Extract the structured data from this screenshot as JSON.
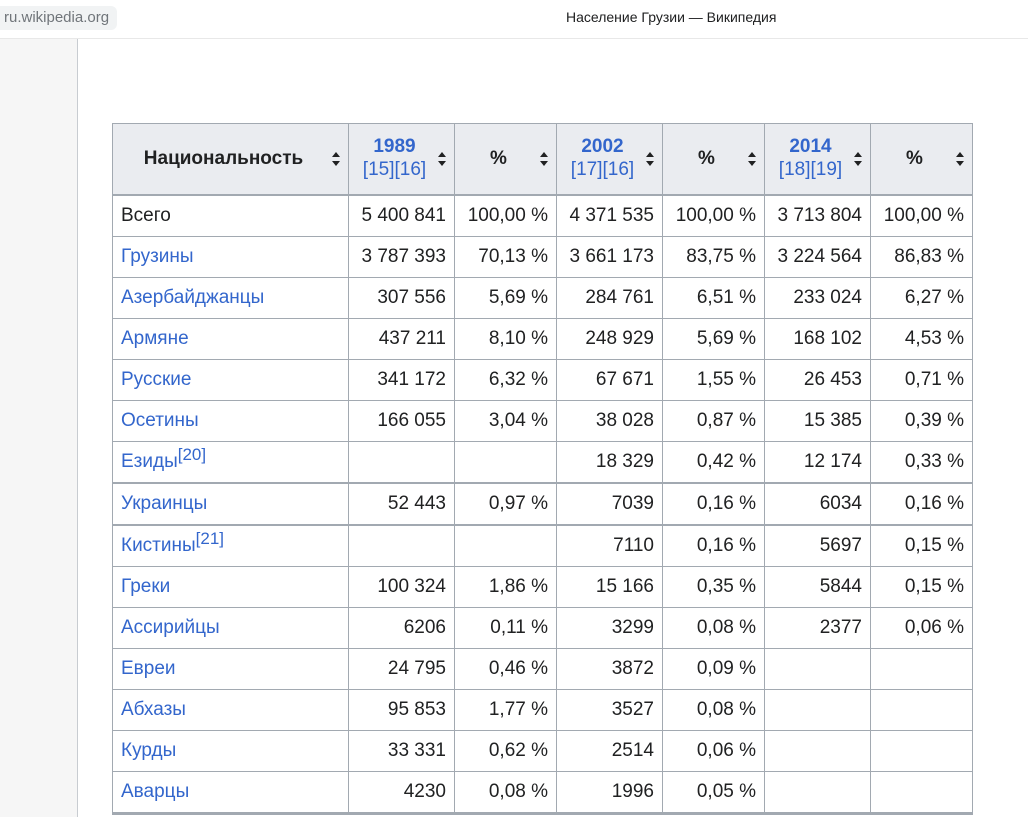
{
  "browser": {
    "url": "ru.wikipedia.org",
    "title": "Население Грузии — Википедия"
  },
  "table": {
    "headers": {
      "nationality": "Национальность",
      "y1989": "1989",
      "y1989_refs": "[15][16]",
      "pct1": "%",
      "y2002": "2002",
      "y2002_refs": "[17][16]",
      "pct2": "%",
      "y2014": "2014",
      "y2014_refs": "[18][19]",
      "pct3": "%"
    },
    "rows": [
      {
        "name": "Всего",
        "sup": "",
        "v1989": "5 400 841",
        "p1989": "100,00 %",
        "v2002": "4 371 535",
        "p2002": "100,00 %",
        "v2014": "3 713 804",
        "p2014": "100,00 %"
      },
      {
        "name": "Грузины",
        "sup": "",
        "v1989": "3 787 393",
        "p1989": "70,13 %",
        "v2002": "3 661 173",
        "p2002": "83,75 %",
        "v2014": "3 224 564",
        "p2014": "86,83 %"
      },
      {
        "name": "Азербайджанцы",
        "sup": "",
        "v1989": "307 556",
        "p1989": "5,69 %",
        "v2002": "284 761",
        "p2002": "6,51 %",
        "v2014": "233 024",
        "p2014": "6,27 %"
      },
      {
        "name": "Армяне",
        "sup": "",
        "v1989": "437 211",
        "p1989": "8,10 %",
        "v2002": "248 929",
        "p2002": "5,69 %",
        "v2014": "168 102",
        "p2014": "4,53 %"
      },
      {
        "name": "Русские",
        "sup": "",
        "v1989": "341 172",
        "p1989": "6,32 %",
        "v2002": "67 671",
        "p2002": "1,55 %",
        "v2014": "26 453",
        "p2014": "0,71 %"
      },
      {
        "name": "Осетины",
        "sup": "",
        "v1989": "166 055",
        "p1989": "3,04 %",
        "v2002": "38 028",
        "p2002": "0,87 %",
        "v2014": "15 385",
        "p2014": "0,39 %"
      },
      {
        "name": "Езиды",
        "sup": "[20]",
        "v1989": "",
        "p1989": "",
        "v2002": "18 329",
        "p2002": "0,42 %",
        "v2014": "12 174",
        "p2014": "0,33 %"
      },
      {
        "name": "Украинцы",
        "sup": "",
        "v1989": "52 443",
        "p1989": "0,97 %",
        "v2002": "7039",
        "p2002": "0,16 %",
        "v2014": "6034",
        "p2014": "0,16 %"
      },
      {
        "name": "Кистины",
        "sup": "[21]",
        "v1989": "",
        "p1989": "",
        "v2002": "7110",
        "p2002": "0,16 %",
        "v2014": "5697",
        "p2014": "0,15 %"
      },
      {
        "name": "Греки",
        "sup": "",
        "v1989": "100 324",
        "p1989": "1,86 %",
        "v2002": "15 166",
        "p2002": "0,35 %",
        "v2014": "5844",
        "p2014": "0,15 %"
      },
      {
        "name": "Ассирийцы",
        "sup": "",
        "v1989": "6206",
        "p1989": "0,11 %",
        "v2002": "3299",
        "p2002": "0,08 %",
        "v2014": "2377",
        "p2014": "0,06 %"
      },
      {
        "name": "Евреи",
        "sup": "",
        "v1989": "24 795",
        "p1989": "0,46 %",
        "v2002": "3872",
        "p2002": "0,09 %",
        "v2014": "",
        "p2014": ""
      },
      {
        "name": "Абхазы",
        "sup": "",
        "v1989": "95 853",
        "p1989": "1,77 %",
        "v2002": "3527",
        "p2002": "0,08 %",
        "v2014": "",
        "p2014": ""
      },
      {
        "name": "Курды",
        "sup": "",
        "v1989": "33 331",
        "p1989": "0,62 %",
        "v2002": "2514",
        "p2002": "0,06 %",
        "v2014": "",
        "p2014": ""
      },
      {
        "name": "Аварцы",
        "sup": "",
        "v1989": "4230",
        "p1989": "0,08 %",
        "v2002": "1996",
        "p2002": "0,05 %",
        "v2014": "",
        "p2014": ""
      }
    ]
  },
  "colors": {
    "link": "#3366cc",
    "header_bg": "#eaecf0",
    "border": "#a2a9b1"
  }
}
